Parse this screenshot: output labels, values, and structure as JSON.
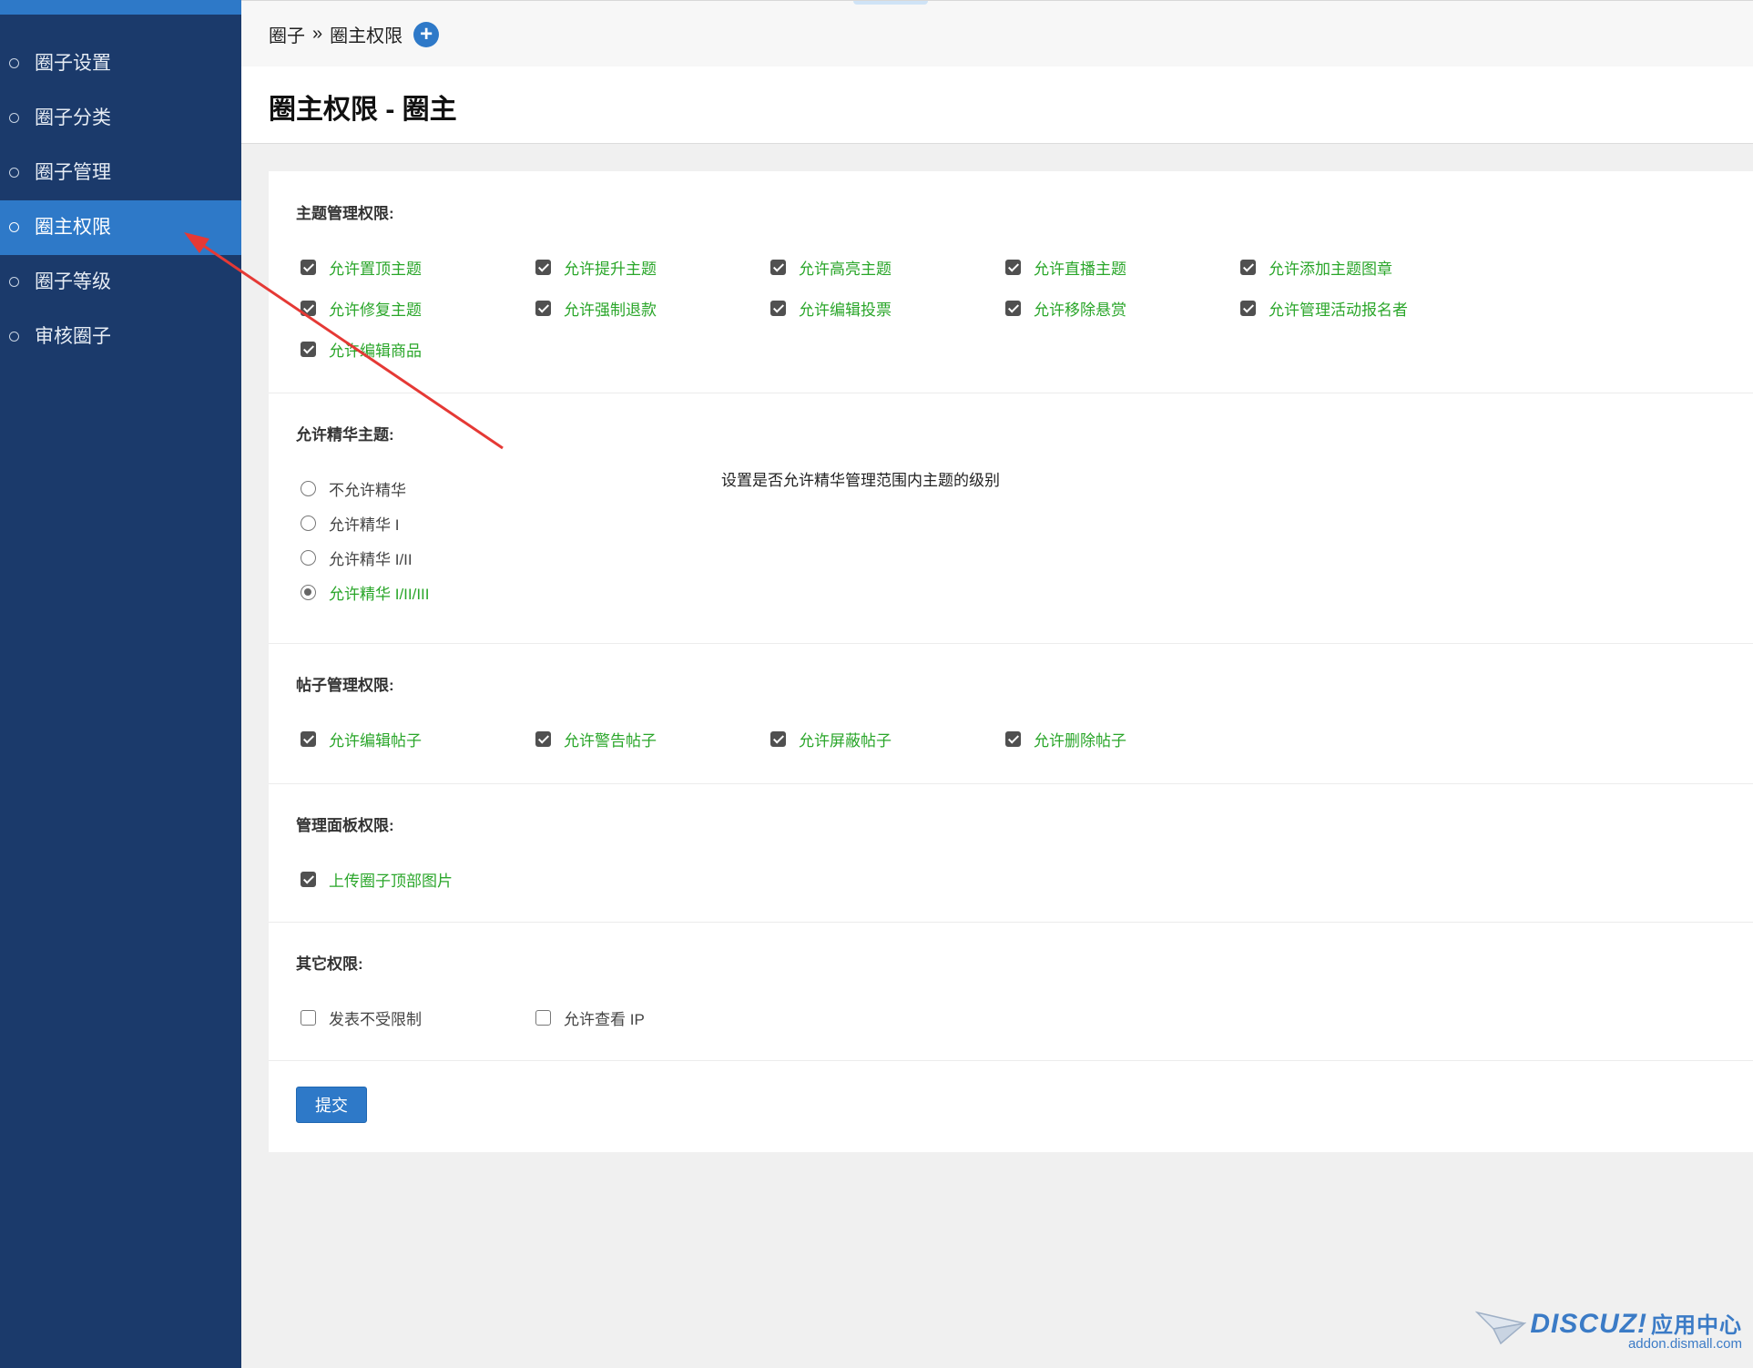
{
  "sidebar": {
    "items": [
      {
        "label": "圈子设置",
        "active": false
      },
      {
        "label": "圈子分类",
        "active": false
      },
      {
        "label": "圈子管理",
        "active": false
      },
      {
        "label": "圈主权限",
        "active": true
      },
      {
        "label": "圈子等级",
        "active": false
      },
      {
        "label": "审核圈子",
        "active": false
      }
    ]
  },
  "breadcrumb": {
    "root": "圈子",
    "sep": "»",
    "current": "圈主权限",
    "add_icon": "+"
  },
  "page_title": "圈主权限 - 圈主",
  "sections": {
    "topic": {
      "title": "主题管理权限:",
      "options": [
        {
          "label": "允许置顶主题",
          "checked": true
        },
        {
          "label": "允许提升主题",
          "checked": true
        },
        {
          "label": "允许高亮主题",
          "checked": true
        },
        {
          "label": "允许直播主题",
          "checked": true
        },
        {
          "label": "允许添加主题图章",
          "checked": true
        },
        {
          "label": "允许修复主题",
          "checked": true
        },
        {
          "label": "允许强制退款",
          "checked": true
        },
        {
          "label": "允许编辑投票",
          "checked": true
        },
        {
          "label": "允许移除悬赏",
          "checked": true
        },
        {
          "label": "允许管理活动报名者",
          "checked": true
        },
        {
          "label": "允许编辑商品",
          "checked": true
        }
      ]
    },
    "digest": {
      "title": "允许精华主题:",
      "options": [
        {
          "label": "不允许精华",
          "selected": false
        },
        {
          "label": "允许精华 I",
          "selected": false
        },
        {
          "label": "允许精华 I/II",
          "selected": false
        },
        {
          "label": "允许精华 I/II/III",
          "selected": true
        }
      ],
      "hint": "设置是否允许精华管理范围内主题的级别"
    },
    "post": {
      "title": "帖子管理权限:",
      "options": [
        {
          "label": "允许编辑帖子",
          "checked": true
        },
        {
          "label": "允许警告帖子",
          "checked": true
        },
        {
          "label": "允许屏蔽帖子",
          "checked": true
        },
        {
          "label": "允许删除帖子",
          "checked": true
        }
      ]
    },
    "panel": {
      "title": "管理面板权限:",
      "options": [
        {
          "label": "上传圈子顶部图片",
          "checked": true
        }
      ]
    },
    "other": {
      "title": "其它权限:",
      "options": [
        {
          "label": "发表不受限制",
          "checked": false
        },
        {
          "label": "允许查看 IP",
          "checked": false
        }
      ]
    }
  },
  "submit_label": "提交",
  "watermark": {
    "brand": "DISCUZ!",
    "brand_cn": "应用中心",
    "domain": "addon.dismall.com"
  },
  "colors": {
    "sidebar_bg": "#1b3a6b",
    "accent": "#2e79c8",
    "checked_label": "#2aa62a",
    "annotation_arrow": "#e53935"
  }
}
